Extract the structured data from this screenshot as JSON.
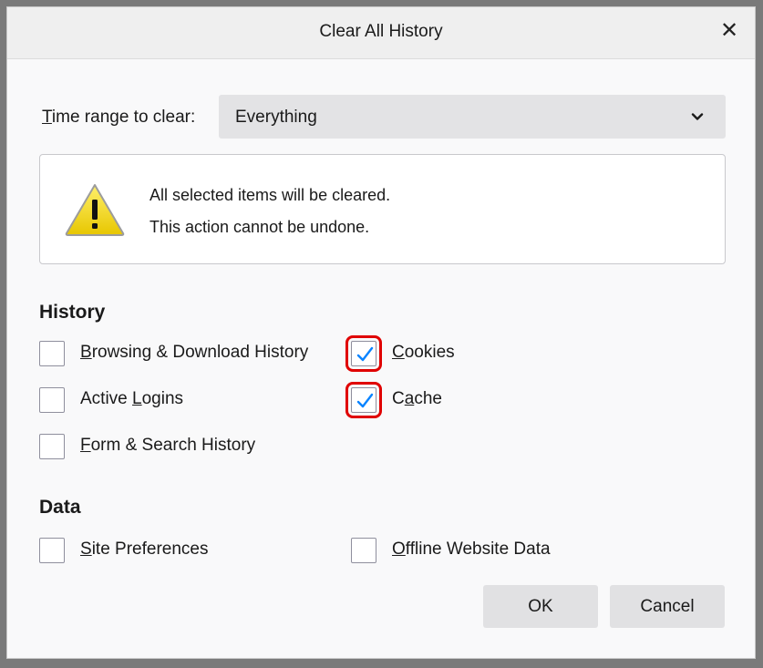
{
  "dialog": {
    "title": "Clear All History",
    "close_glyph": "✕"
  },
  "time_range": {
    "label_first": "T",
    "label_rest": "ime range to clear:",
    "value": "Everything"
  },
  "warning": {
    "icon": "warning-triangle-icon",
    "line1": "All selected items will be cleared.",
    "line2": "This action cannot be undone."
  },
  "history": {
    "heading": "History",
    "items": [
      {
        "pre": "",
        "ul": "B",
        "post": "rowsing & Download History",
        "checked": false
      },
      {
        "pre": "",
        "ul": "C",
        "post": "ookies",
        "checked": true
      },
      {
        "pre": "Active ",
        "ul": "L",
        "post": "ogins",
        "checked": false
      },
      {
        "pre": "C",
        "ul": "a",
        "post": "che",
        "checked": true
      },
      {
        "pre": "",
        "ul": "F",
        "post": "orm & Search History",
        "checked": false
      }
    ]
  },
  "data": {
    "heading": "Data",
    "items": [
      {
        "pre": "",
        "ul": "S",
        "post": "ite Preferences",
        "checked": false
      },
      {
        "pre": "",
        "ul": "O",
        "post": "ffline Website Data",
        "checked": false
      }
    ]
  },
  "buttons": {
    "ok": "OK",
    "cancel": "Cancel"
  },
  "colors": {
    "check": "#0a84ff",
    "highlight": "#e00000",
    "warning_fill": "#f5d90a"
  }
}
